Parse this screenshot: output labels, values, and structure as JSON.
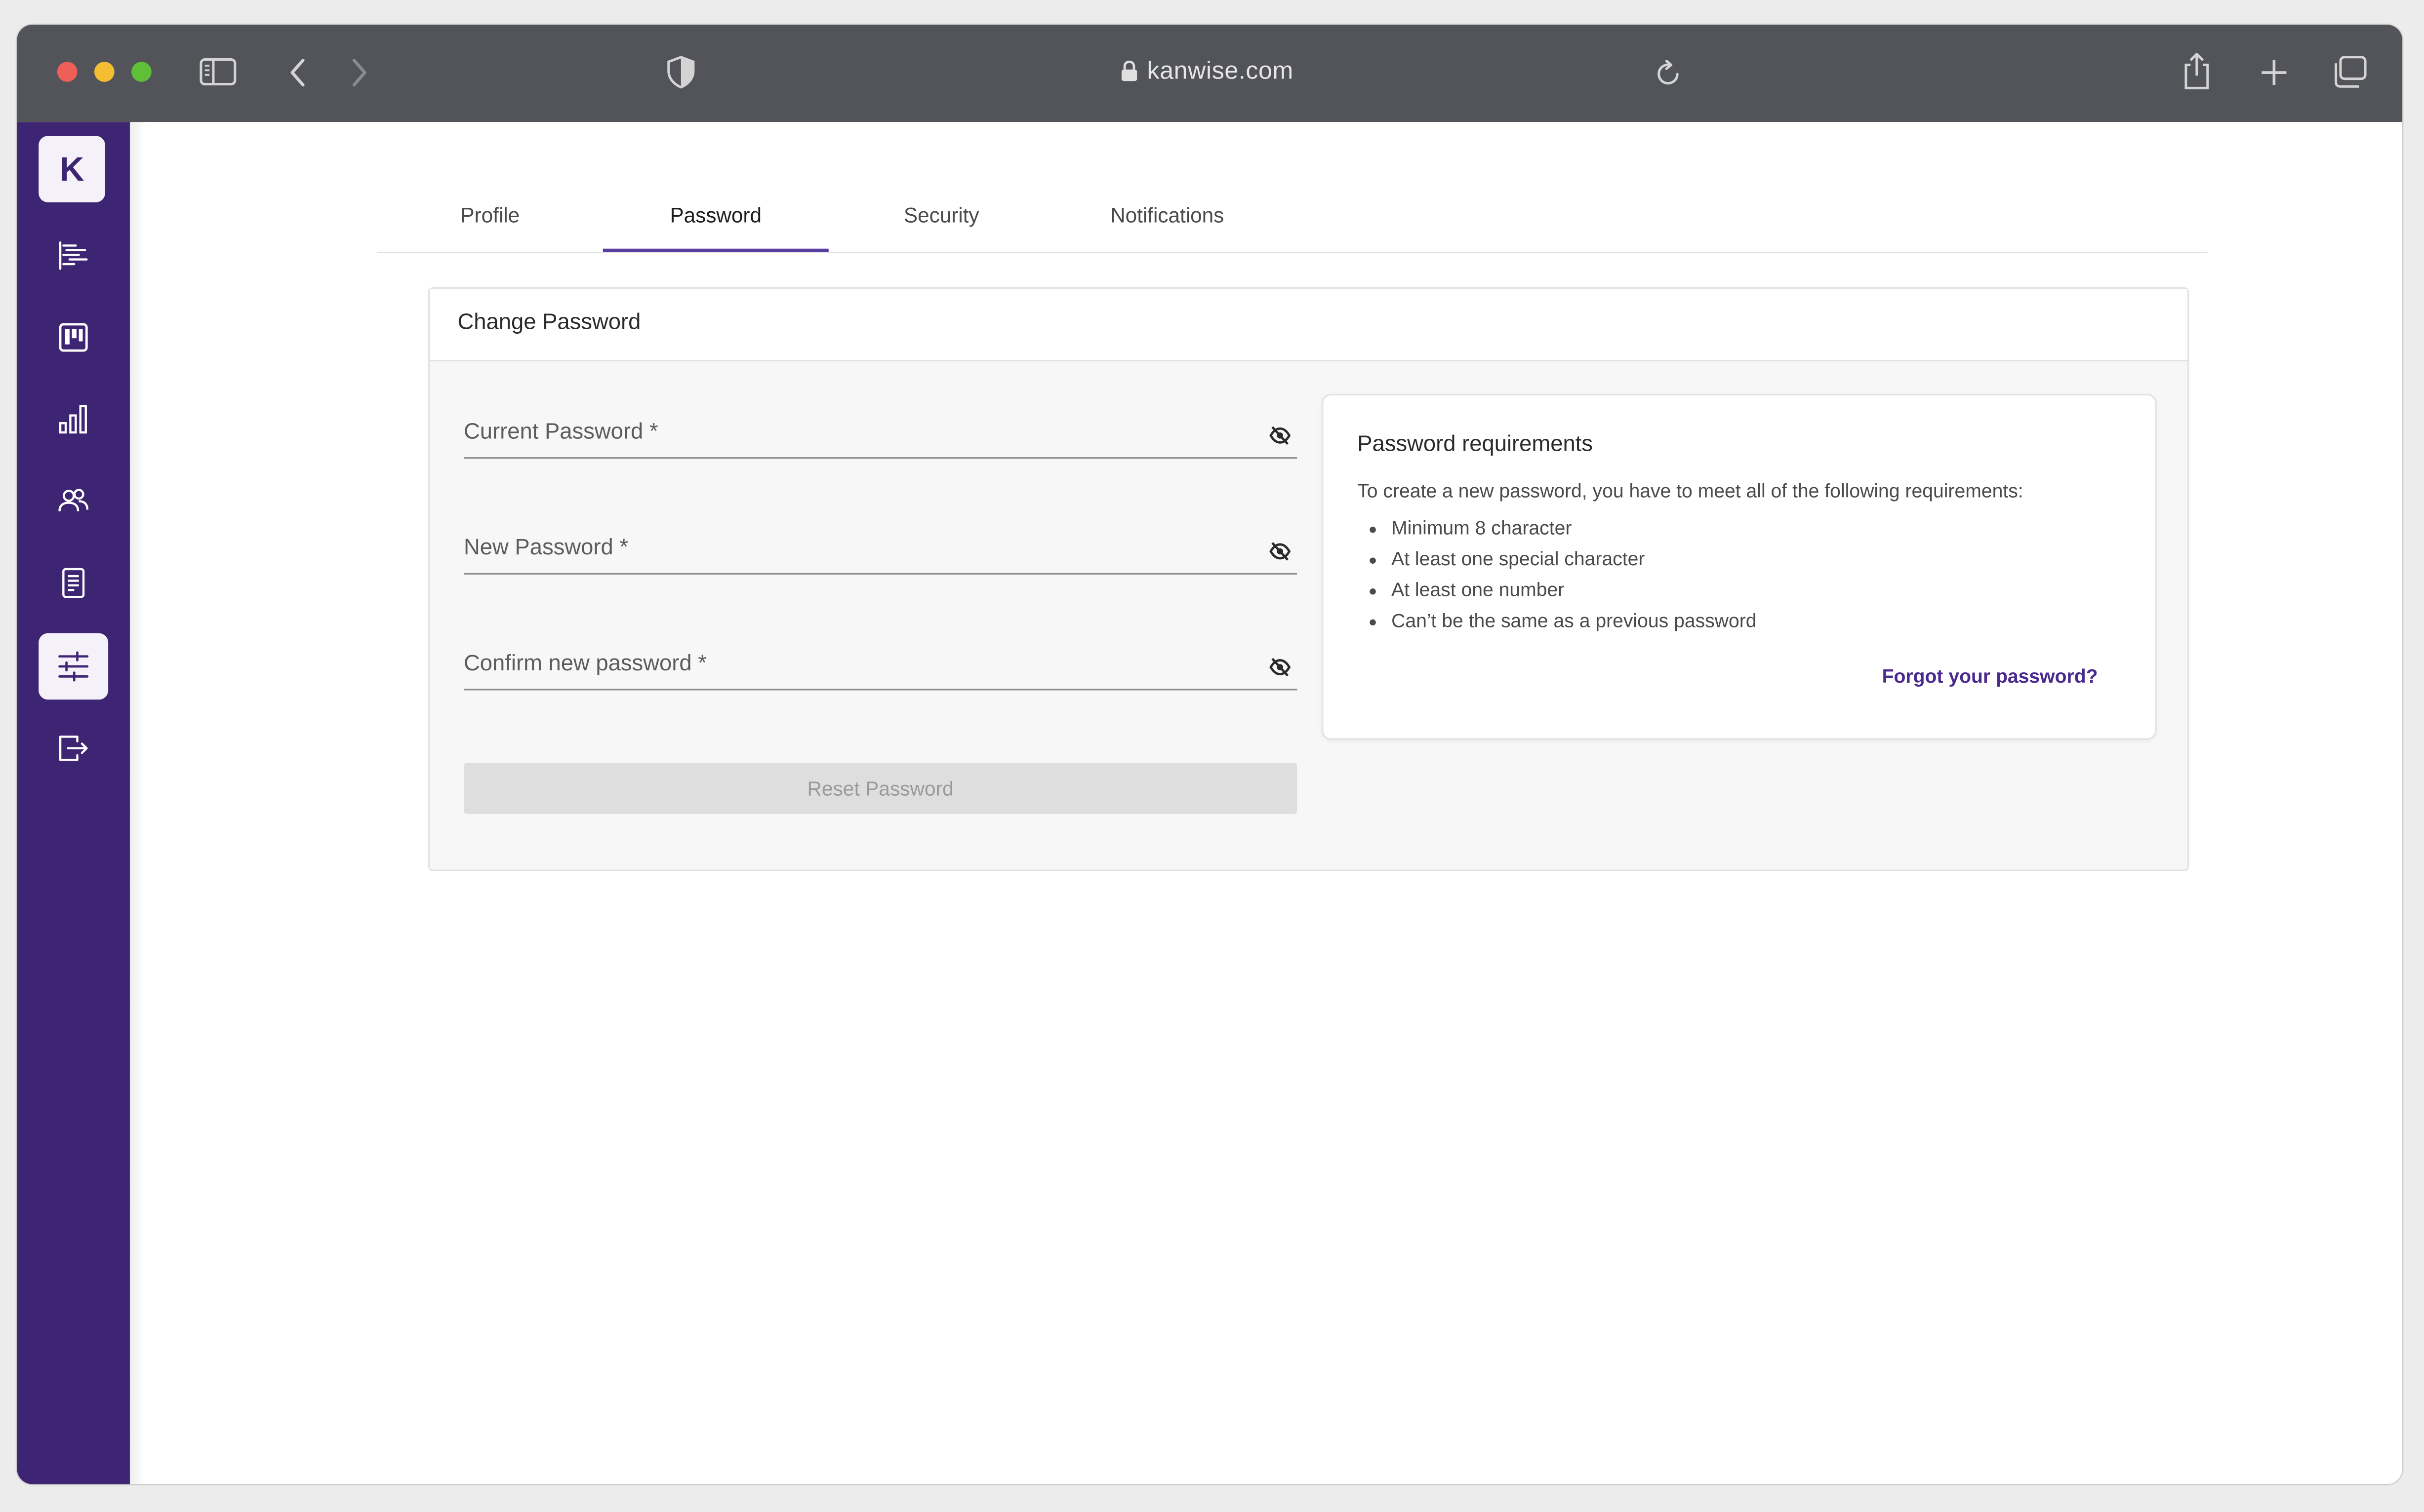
{
  "browser": {
    "url": "kanwise.com",
    "traffic_lights": {
      "close": "#ee5f57",
      "minimize": "#f5bd31",
      "zoom": "#5fc038"
    }
  },
  "sidebar": {
    "logo": "K",
    "items": [
      {
        "icon": "timeline-icon"
      },
      {
        "icon": "kanban-board-icon"
      },
      {
        "icon": "bar-chart-icon"
      },
      {
        "icon": "users-icon"
      },
      {
        "icon": "document-icon"
      },
      {
        "icon": "settings-sliders-icon",
        "active": true
      },
      {
        "icon": "logout-icon"
      }
    ],
    "bg_color": "#3e2573"
  },
  "tabs": [
    {
      "label": "Profile"
    },
    {
      "label": "Password",
      "active": true
    },
    {
      "label": "Security"
    },
    {
      "label": "Notifications"
    }
  ],
  "change_password": {
    "title": "Change Password",
    "fields": [
      {
        "label": "Current Password *",
        "value": ""
      },
      {
        "label": "New Password *",
        "value": ""
      },
      {
        "label": "Confirm new password *",
        "value": ""
      }
    ],
    "reset_button": "Reset Password"
  },
  "requirements": {
    "title": "Password requirements",
    "intro": "To create a new password, you have to meet all of the following requirements:",
    "items": [
      "Minimum 8 character",
      "At least one special character",
      "At least one number",
      "Can’t be the same as a previous password"
    ],
    "forgot_link": "Forgot your password?"
  },
  "accent_color": "#5a3ba1"
}
